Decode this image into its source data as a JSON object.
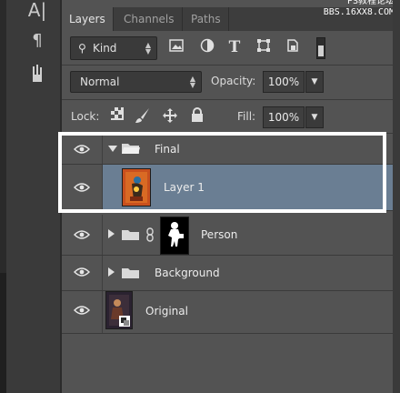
{
  "tabs": [
    {
      "label": "Layers"
    },
    {
      "label": "Channels"
    },
    {
      "label": "Paths"
    }
  ],
  "watermark": {
    "line1": "PS教程论坛",
    "line2": "BBS.16XX8.COM"
  },
  "filter": {
    "kind_label": "Kind"
  },
  "blend": {
    "mode": "Normal",
    "opacity_label": "Opacity:",
    "opacity_value": "100%"
  },
  "lock": {
    "label": "Lock:",
    "fill_label": "Fill:",
    "fill_value": "100%"
  },
  "layers": [
    {
      "name": "Final",
      "type": "group",
      "expanded": true
    },
    {
      "name": "Layer 1",
      "type": "layer",
      "selected": true
    },
    {
      "name": "Person",
      "type": "group",
      "expanded": false,
      "has_mask": true
    },
    {
      "name": "Background",
      "type": "group",
      "expanded": false
    },
    {
      "name": "Original",
      "type": "smart-object"
    }
  ],
  "tools": {
    "type_tool": "A|",
    "paragraph": "¶"
  },
  "colors": {
    "panel": "#535353",
    "selected_row": "#6a7e93",
    "highlight": "#ffffff"
  }
}
